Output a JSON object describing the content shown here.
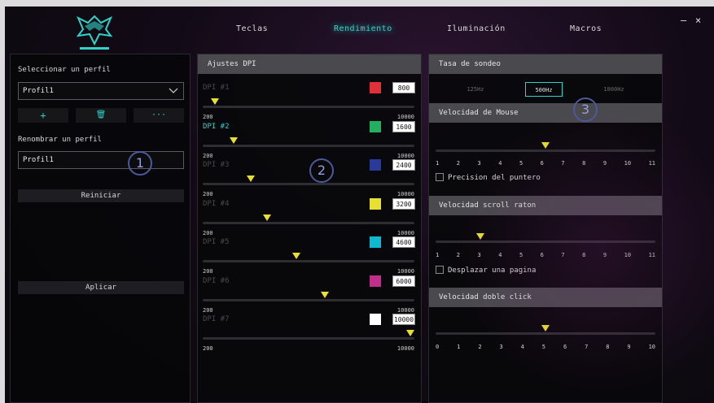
{
  "nav": {
    "tabs": [
      {
        "label": "Teclas"
      },
      {
        "label": "Rendimiento"
      },
      {
        "label": "Iluminación"
      },
      {
        "label": "Macros"
      }
    ],
    "minimize": "–",
    "close": "×"
  },
  "profile": {
    "select_label": "Seleccionar un perfil",
    "selected": "Profil1",
    "rename_label": "Renombrar un perfil",
    "rename_value": "Profil1",
    "reset_label": "Reiniciar",
    "apply_label": "Aplicar",
    "add_icon": "+",
    "delete_icon": "🗑",
    "more_icon": "···"
  },
  "annotations": [
    "1",
    "2",
    "3"
  ],
  "dpi": {
    "title": "Ajustes DPI",
    "range_min": "200",
    "range_max": "10000",
    "levels": [
      {
        "name": "DPI #1",
        "value": "800",
        "color": "#e0303a",
        "active": false,
        "fraction": 0.06
      },
      {
        "name": "DPI #2",
        "value": "1600",
        "color": "#22b060",
        "active": true,
        "fraction": 0.15
      },
      {
        "name": "DPI #3",
        "value": "2400",
        "color": "#2a3a9a",
        "active": false,
        "fraction": 0.23
      },
      {
        "name": "DPI #4",
        "value": "3200",
        "color": "#e8e030",
        "active": false,
        "fraction": 0.31
      },
      {
        "name": "DPI #5",
        "value": "4600",
        "color": "#10b8d0",
        "active": false,
        "fraction": 0.45
      },
      {
        "name": "DPI #6",
        "value": "6000",
        "color": "#c0308a",
        "active": false,
        "fraction": 0.59
      },
      {
        "name": "DPI #7",
        "value": "10000",
        "color": "#ffffff",
        "active": false,
        "fraction": 1.0
      }
    ]
  },
  "polling": {
    "title": "Tasa de sondeo",
    "options": [
      "125Hz",
      "500Hz",
      "1000Hz"
    ],
    "selected": "500Hz"
  },
  "mouse_speed": {
    "title": "Velocidad de Mouse",
    "ticks": [
      "1",
      "2",
      "3",
      "4",
      "5",
      "6",
      "7",
      "8",
      "9",
      "10",
      "11"
    ],
    "value": 6,
    "checkbox_label": "Precision del puntero"
  },
  "scroll_speed": {
    "title": "Velocidad scroll raton",
    "ticks": [
      "1",
      "2",
      "3",
      "4",
      "5",
      "6",
      "7",
      "8",
      "9",
      "10",
      "11"
    ],
    "value": 3,
    "checkbox_label": "Desplazar una pagina"
  },
  "double_click": {
    "title": "Velocidad doble click",
    "ticks": [
      "0",
      "1",
      "2",
      "3",
      "4",
      "5",
      "6",
      "7",
      "8",
      "9",
      "10"
    ],
    "value": 5
  }
}
